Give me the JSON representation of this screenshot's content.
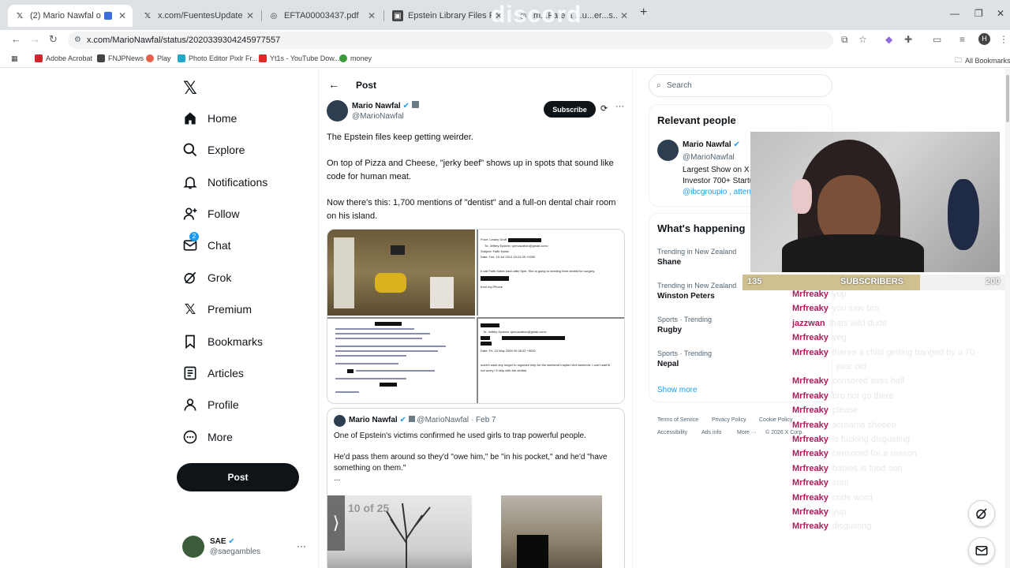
{
  "browser": {
    "tabs": [
      {
        "title": "(2) Mario Nawfal on X: \"The",
        "icon": "x-logo-icon",
        "active": true
      },
      {
        "title": "x.com/FuentesUpdates/status/",
        "icon": "x-logo-icon",
        "active": false
      },
      {
        "title": "EFTA00003437.pdf",
        "icon": "globe-icon",
        "active": false
      },
      {
        "title": "Epstein Library Files Public Arch",
        "icon": "library-icon",
        "active": false
      },
      {
        "title": "m...Fate a ...u...er...s...pstein",
        "icon": "globe-icon",
        "active": false
      }
    ],
    "overlay_text": "discord",
    "url": "x.com/MarioNawfal/status/2020339304245977557",
    "bookmarks": [
      {
        "label": "Adobe Acrobat",
        "color": "#d4242a"
      },
      {
        "label": "FNJPNews",
        "color": "#444444"
      },
      {
        "label": "Play",
        "color": "#e8604c"
      },
      {
        "label": "Photo Editor Pixlr Fr...",
        "color": "#22a9c8"
      },
      {
        "label": "Yt1s - YouTube Dow...",
        "color": "#e02828"
      },
      {
        "label": "money",
        "color": "#3a9a3a"
      }
    ],
    "all_bookmarks": "All Bookmarks"
  },
  "nav": {
    "items": [
      {
        "label": "Home",
        "icon": "home-icon"
      },
      {
        "label": "Explore",
        "icon": "search-icon"
      },
      {
        "label": "Notifications",
        "icon": "bell-icon"
      },
      {
        "label": "Follow",
        "icon": "add-person-icon"
      },
      {
        "label": "Chat",
        "icon": "mail-icon",
        "badge": "2"
      },
      {
        "label": "Grok",
        "icon": "grok-icon"
      },
      {
        "label": "Premium",
        "icon": "x-logo-icon"
      },
      {
        "label": "Bookmarks",
        "icon": "bookmark-icon"
      },
      {
        "label": "Articles",
        "icon": "article-icon"
      },
      {
        "label": "Profile",
        "icon": "person-icon"
      },
      {
        "label": "More",
        "icon": "more-circle-icon"
      }
    ],
    "post_button": "Post",
    "account": {
      "name": "SAE",
      "handle": "@saegambles"
    }
  },
  "post": {
    "header_title": "Post",
    "author_name": "Mario Nawfal",
    "author_handle": "@MarioNawfal",
    "subscribe_label": "Subscribe",
    "paragraphs": [
      "The Epstein files keep getting weirder.",
      "On top of Pizza and Cheese, \"jerky beef\" shows up in spots that sound like code for human meat.",
      "Now there's this: 1,700 mentions of \"dentist\" and a full-on dental chair room on his island."
    ],
    "doc_labels": {
      "from_line": "From: Lesley Groff",
      "to_line": "To: Jeffrey Epstein <jeevacation@gmail.com>",
      "subject_line": "Subject: Faith Kates",
      "date_line": "Date: Tue, 15 Jul 2014 16:24:39 +0000",
      "body_line": "e call Faith Kates back after 5pm. She is going to meeting thee dentist for surgery.",
      "sent_line": "from my iPhone",
      "to_line2": "To: Jeffrey Epstein <jeevacation@gmail.com>",
      "date_line2": "Date: Fri, 15 May 2009 00:38:32 +0000",
      "body_line2": "ouldn't want any longer to organize help for the weekend maybe next weekend. I can't wait til",
      "body_line3": "not worry I ll help with the dentist"
    },
    "quote": {
      "author_name": "Mario Nawfal",
      "author_handle": "@MarioNawfal",
      "date": "· Feb 7",
      "para1": "One of Epstein's victims confirmed he used girls to trap powerful people.",
      "para2": "He'd pass them around so they'd \"owe him,\" be \"in his pocket,\" and he'd \"have something on them.\"",
      "ellipsis": "...",
      "counter": "10 of 25"
    }
  },
  "right": {
    "search_placeholder": "Search",
    "relevant_title": "Relevant people",
    "rel_name": "Mario Nawfal",
    "rel_handle": "@MarioNawfal",
    "rel_bio1": "Largest Show on X |",
    "rel_bio2": "Investor 700+ Startu",
    "rel_bio3": "@ibcgroupio , atten",
    "happening_title": "What's happening",
    "trends": [
      {
        "meta": "Trending in New Zealand",
        "name": "Shane"
      },
      {
        "meta": "Trending in New Zealand",
        "name": "Winston Peters"
      },
      {
        "meta": "Sports · Trending",
        "name": "Rugby"
      },
      {
        "meta": "Sports · Trending",
        "name": "Nepal"
      }
    ],
    "show_more": "Show more",
    "footer": [
      "Terms of Service",
      "Privacy Policy",
      "Cookie Policy",
      "Accessibility",
      "Ads info",
      "More ···",
      "© 2026 X Corp."
    ]
  },
  "stream": {
    "subs_current": "135",
    "subs_label": "SUBSCRIBERS",
    "subs_goal": "200",
    "subs_progress_fraction": 0.675,
    "chat": [
      {
        "user": "Mrfreaky",
        "msg": "yup"
      },
      {
        "user": "Mrfreaky",
        "msg": "you saw bro"
      },
      {
        "user": "jazzwan",
        "msg": "thats wild dude"
      },
      {
        "user": "Mrfreaky",
        "msg": "yeg"
      },
      {
        "user": "Mrfreaky",
        "msg": "theres a child getting banged by a 70"
      },
      {
        "user": "",
        "msg": "year old"
      },
      {
        "user": "Mrfreaky",
        "msg": "censored asss hell"
      },
      {
        "user": "Mrfreaky",
        "msg": "bro not go there"
      },
      {
        "user": "Mrfreaky",
        "msg": "please"
      },
      {
        "user": "Mrfreaky",
        "msg": "screams sheeee"
      },
      {
        "user": "Mrfreaky",
        "msg": "is fucking disgusting"
      },
      {
        "user": "Mrfreaky",
        "msg": "censored for a reason"
      },
      {
        "user": "Mrfreaky",
        "msg": "babies is food son"
      },
      {
        "user": "Mrfreaky",
        "msg": "sum"
      },
      {
        "user": "Mrfreaky",
        "msg": "code word"
      },
      {
        "user": "Mrfreaky",
        "msg": "yup"
      },
      {
        "user": "Mrfreaky",
        "msg": "disgusting"
      }
    ]
  }
}
